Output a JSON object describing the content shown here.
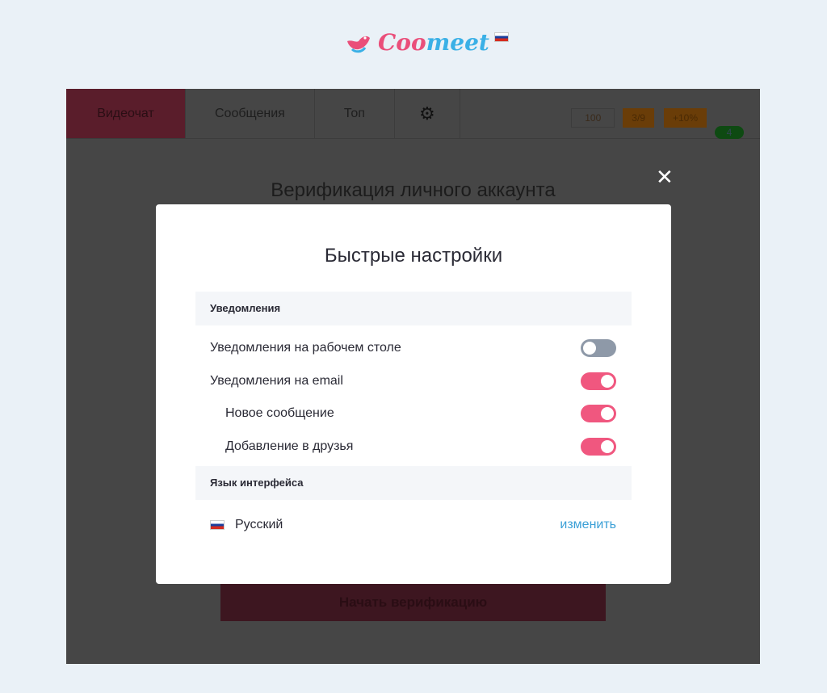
{
  "logo": {
    "text_a": "Coo",
    "text_b": "meet"
  },
  "nav": {
    "tabs": [
      "Видеочат",
      "Сообщения",
      "Топ"
    ],
    "stats": [
      "100",
      "3/9",
      "+10%"
    ],
    "badge": "4"
  },
  "background": {
    "title": "Верификация личного аккаунта",
    "button": "Начать верификацию"
  },
  "modal": {
    "title": "Быстрые настройки",
    "notifications_header": "Уведомления",
    "toggles": [
      {
        "label": "Уведомления на рабочем столе",
        "on": false
      },
      {
        "label": "Уведомления на email",
        "on": true
      },
      {
        "label": "Новое сообщение",
        "on": true
      },
      {
        "label": "Добавление в друзья",
        "on": true
      }
    ],
    "language_header": "Язык интерфейса",
    "language": "Русский",
    "change": "изменить"
  },
  "colors": {
    "accent": "#f0577f",
    "link": "#3a9fd6"
  }
}
